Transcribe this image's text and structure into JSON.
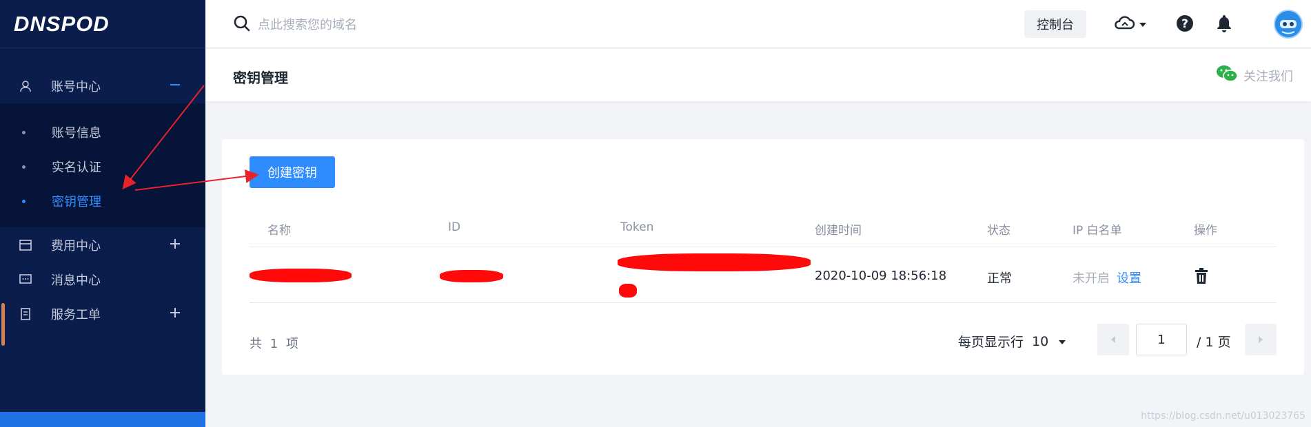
{
  "sidebar": {
    "logo": "DNSPOD",
    "groups": [
      {
        "label": "账号中心",
        "icon": "user-icon",
        "toggle": "minus-icon"
      },
      {
        "label": "费用中心",
        "icon": "billing-icon",
        "toggle": "plus-icon"
      },
      {
        "label": "消息中心",
        "icon": "message-icon",
        "toggle": ""
      },
      {
        "label": "服务工单",
        "icon": "ticket-icon",
        "toggle": "plus-icon"
      }
    ],
    "account_items": [
      {
        "label": "账号信息",
        "active": false
      },
      {
        "label": "实名认证",
        "active": false
      },
      {
        "label": "密钥管理",
        "active": true
      }
    ]
  },
  "header": {
    "search_placeholder": "点此搜索您的域名",
    "console_label": "控制台",
    "icons": [
      "cloud-icon",
      "help-icon",
      "bell-icon"
    ]
  },
  "page": {
    "title": "密钥管理",
    "follow_label": "关注我们"
  },
  "table": {
    "create_label": "创建密钥",
    "columns": [
      "名称",
      "ID",
      "Token",
      "创建时间",
      "状态",
      "IP 白名单",
      "操作"
    ],
    "rows": [
      {
        "name": "",
        "id": "",
        "token": "",
        "created": "2020-10-09 18:56:18",
        "status": "正常",
        "ip_status": "未开启",
        "ip_action": "设置"
      }
    ]
  },
  "pagination": {
    "total_text": "共 1 项",
    "page_size_label": "每页显示行",
    "page_size": "10",
    "current_page": "1",
    "total_pages_text": "/ 1 页"
  },
  "watermark": "https://blog.csdn.net/u013023765",
  "colors": {
    "sidebar_bg": "#0a1d4c",
    "accent": "#2f8cff",
    "annotation": "#e8232b"
  }
}
